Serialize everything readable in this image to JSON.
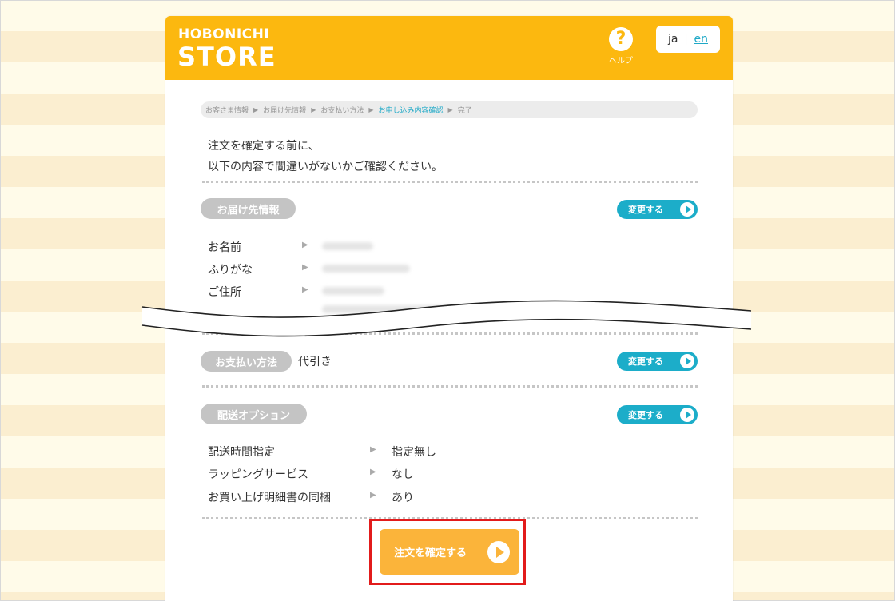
{
  "header": {
    "logo_top": "HOBONICHI",
    "logo_bottom": "STORE",
    "help_symbol": "?",
    "help_label": "ヘルプ",
    "lang_ja": "ja",
    "lang_sep": "|",
    "lang_en": "en"
  },
  "breadcrumb": {
    "steps": [
      "お客さま情報",
      "お届け先情報",
      "お支払い方法",
      "お申し込み内容確認",
      "完了"
    ],
    "active_index": 3,
    "separator": "▶"
  },
  "intro": {
    "line1": "注文を確定する前に、",
    "line2": "以下の内容で間違いがないかご確認ください。"
  },
  "delivery": {
    "title": "お届け先情報",
    "change_label": "変更する",
    "rows": [
      {
        "label": "お名前",
        "arrow": "▶"
      },
      {
        "label": "ふりがな",
        "arrow": "▶"
      },
      {
        "label": "ご住所",
        "arrow": "▶"
      }
    ]
  },
  "payment": {
    "title": "お支払い方法",
    "value": "代引き",
    "change_label": "変更する"
  },
  "shipping": {
    "title": "配送オプション",
    "change_label": "変更する",
    "rows": [
      {
        "label": "配送時間指定",
        "arrow": "▶",
        "value": "指定無し"
      },
      {
        "label": "ラッピングサービス",
        "arrow": "▶",
        "value": "なし"
      },
      {
        "label": "お買い上げ明細書の同梱",
        "arrow": "▶",
        "value": "あり"
      }
    ]
  },
  "confirm": {
    "label": "注文を確定する"
  },
  "colors": {
    "brand": "#fcb80f",
    "accent": "#1cadc9",
    "confirm": "#fbb43a",
    "highlight": "#e21b1b"
  }
}
